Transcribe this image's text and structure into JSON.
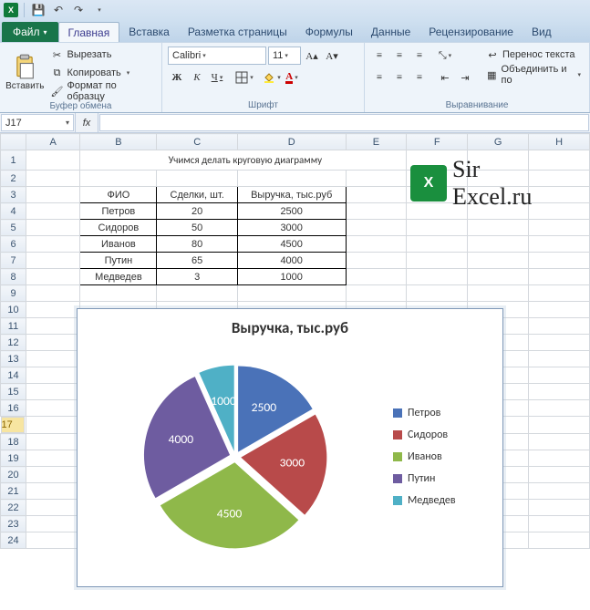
{
  "qat": {
    "app": "X"
  },
  "ribbon": {
    "file": "Файл",
    "tabs": [
      "Главная",
      "Вставка",
      "Разметка страницы",
      "Формулы",
      "Данные",
      "Рецензирование",
      "Вид"
    ],
    "active_tab": 0,
    "clipboard": {
      "paste": "Вставить",
      "cut": "Вырезать",
      "copy": "Копировать",
      "format_painter": "Формат по образцу",
      "group": "Буфер обмена"
    },
    "font": {
      "name": "Calibri",
      "size": "11",
      "bold": "Ж",
      "italic": "К",
      "underline": "Ч",
      "group": "Шрифт"
    },
    "align": {
      "wrap": "Перенос текста",
      "merge": "Объединить и по",
      "group": "Выравнивание"
    }
  },
  "formula_bar": {
    "cell_ref": "J17",
    "fx": "fx",
    "value": ""
  },
  "columns": [
    "A",
    "B",
    "C",
    "D",
    "E",
    "F",
    "G",
    "H"
  ],
  "rows_visible": 24,
  "selected_row": 17,
  "sheet": {
    "title": "Учимся делать круговую диаграмму",
    "headers": [
      "ФИО",
      "Сделки, шт.",
      "Выручка, тыс.руб"
    ],
    "rows": [
      {
        "name": "Петров",
        "deals": "20",
        "rev": "2500"
      },
      {
        "name": "Сидоров",
        "deals": "50",
        "rev": "3000"
      },
      {
        "name": "Иванов",
        "deals": "80",
        "rev": "4500"
      },
      {
        "name": "Путин",
        "deals": "65",
        "rev": "4000"
      },
      {
        "name": "Медведев",
        "deals": "3",
        "rev": "1000"
      }
    ]
  },
  "chart_data": {
    "type": "pie",
    "title": "Выручка, тыс.руб",
    "categories": [
      "Петров",
      "Сидоров",
      "Иванов",
      "Путин",
      "Медведев"
    ],
    "values": [
      2500,
      3000,
      4500,
      4000,
      1000
    ],
    "colors": [
      "#4a72b8",
      "#b84a4a",
      "#8fb84a",
      "#6e5ca0",
      "#4fb0c6"
    ]
  },
  "watermark": {
    "brand": "Sir",
    "domain": "Excel.ru"
  }
}
